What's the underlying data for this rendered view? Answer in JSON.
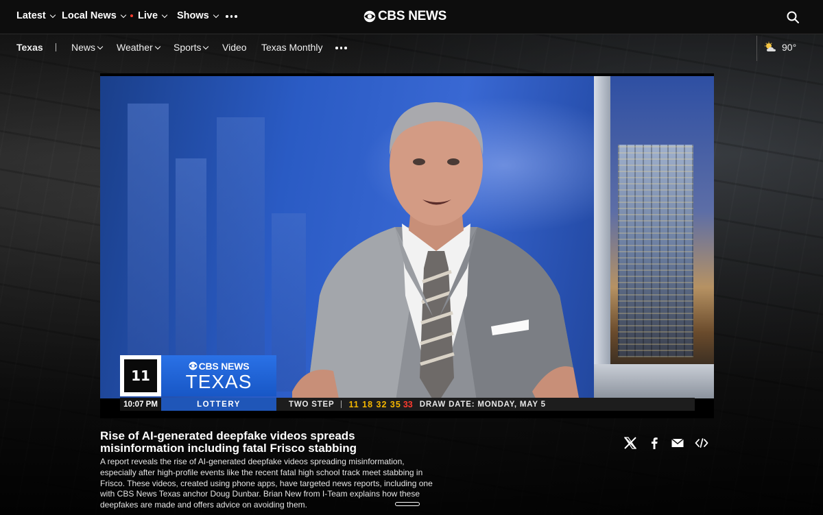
{
  "topnav": {
    "items": [
      {
        "label": "Latest"
      },
      {
        "label": "Local News"
      },
      {
        "label": "Live"
      },
      {
        "label": "Shows"
      }
    ],
    "logo_text": "CBS NEWS"
  },
  "subnav": {
    "region": "Texas",
    "items": [
      {
        "label": "News"
      },
      {
        "label": "Weather"
      },
      {
        "label": "Sports"
      },
      {
        "label": "Video"
      },
      {
        "label": "Texas Monthly"
      }
    ],
    "weather_temp": "90°",
    "weather_icon": "partly-cloudy-icon"
  },
  "video": {
    "channel_bug": "11",
    "brand_top": "CBS NEWS",
    "brand_bottom": "TEXAS",
    "ticker": {
      "time": "10:07 PM",
      "topic": "LOTTERY",
      "game": "TWO STEP",
      "numbers": "11 18 32 35",
      "bonus": "33",
      "draw": "DRAW DATE: MONDAY, MAY 5"
    }
  },
  "article": {
    "headline": "Rise of AI-generated deepfake videos spreads misinformation including fatal Frisco stabbing",
    "description": "A report reveals the rise of AI-generated deepfake videos spreading misinformation, especially after high-profile events like the recent fatal high school track meet stabbing in Frisco. These videos, created using phone apps, have targeted news reports, including one with CBS News Texas anchor Doug Dunbar. Brian New from I-Team explains how these deepfakes are made and offers advice on avoiding them."
  },
  "share": [
    "x-icon",
    "facebook-icon",
    "email-icon",
    "embed-icon"
  ],
  "colors": {
    "accent_live": "#ff3c2e",
    "brand_blue": "#2a71e6",
    "lottery_numbers": "#f5b700",
    "bonus_number": "#ff3b2f"
  }
}
